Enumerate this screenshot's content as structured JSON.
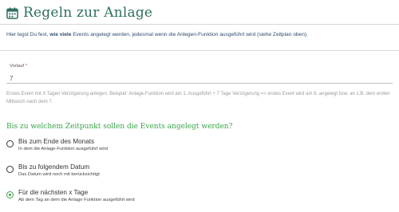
{
  "header": {
    "title": "Regeln zur Anlage",
    "icon": "calendar-icon",
    "icon_color": "#2f6f5f"
  },
  "intro": {
    "part1": "Hier legst Du fest, ",
    "bold": "wie viele",
    "part2": " Events angelegt werden, jedesmal wenn die Anlegen-Funktion ausgeführt wird (siehe Zeitplan oben)."
  },
  "vorlauf": {
    "label": "Vorlauf",
    "required_mark": "*",
    "value": "7"
  },
  "help_text": "Erstes Event mit X Tagen Verzögerung anlegen. Beispiel: Anlage-Funktion wird am 1. Ausgeführt + 7 Tage Verzögerung => erstes Event wird am 8. angelegt bzw. an z.B. dem ersten Mittwoch nach dem 7.",
  "section": {
    "title": "Bis zu welchem Zeitpunkt sollen die Events angelegt werden?",
    "accent_color": "#3aa34a"
  },
  "options": [
    {
      "title": "Bis zum Ende des Monats",
      "subtitle": "In dem die Anlage-Funktion ausgeführt wird",
      "checked": false
    },
    {
      "title": "Bis zu folgendem Datum",
      "subtitle": "Das Datum wird noch mit berücksichtigt",
      "checked": false
    },
    {
      "title": "Für die nächsten x Tage",
      "subtitle": "Ab dem Tag an dem die Anlage Funktion ausgeführt wird",
      "checked": true
    }
  ]
}
